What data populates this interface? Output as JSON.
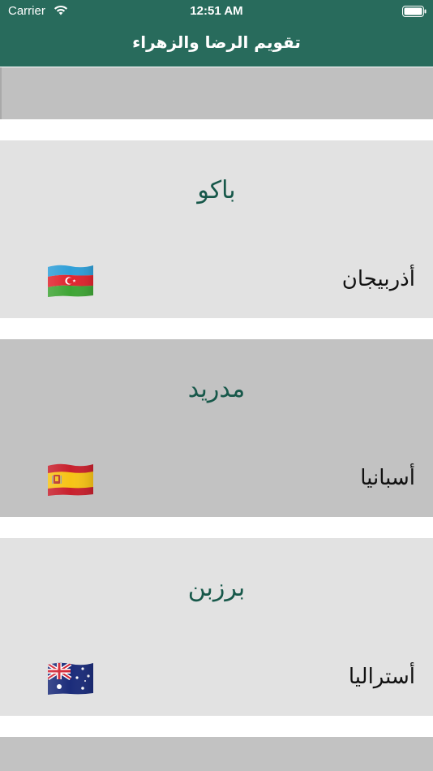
{
  "status_bar": {
    "carrier": "Carrier",
    "time": "12:51 AM"
  },
  "header": {
    "title": "تقويم الرضا والزهراء"
  },
  "colors": {
    "header_bg": "#286b5c",
    "city_text": "#17584a",
    "card_light": "#e2e2e2",
    "card_dark": "#c2c2c2"
  },
  "cities": [
    {
      "city": "باكو",
      "country": "أذربيجان",
      "flag": "azerbaijan-flag-icon"
    },
    {
      "city": "مدريد",
      "country": "أسبانيا",
      "flag": "spain-flag-icon"
    },
    {
      "city": "برزبن",
      "country": "أستراليا",
      "flag": "australia-flag-icon"
    }
  ]
}
